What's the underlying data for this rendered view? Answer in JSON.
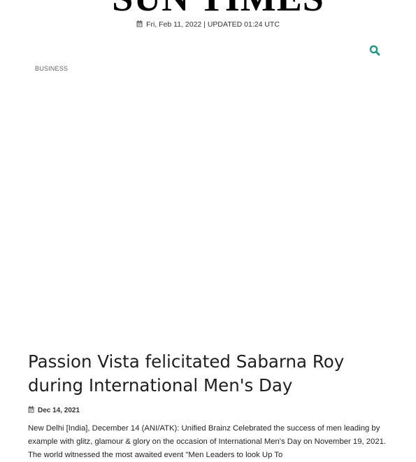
{
  "masthead": {
    "logo_text": "SUN TIMES",
    "date": "Fri, Feb 11, 2022",
    "separator": " | ",
    "updated": "UPDATED 01:24 UTC"
  },
  "header": {
    "search_icon": "search-icon"
  },
  "article": {
    "category": "BUSINESS",
    "title": "Passion Vista felicitated Sabarna Roy during International Men's Day",
    "date": "Dec 14, 2021",
    "body": "New Delhi [India], December 14 (ANI/ATK): Unified Brainz Celebrated the success of men leading by example with glitz, glamour & glory on the occasion of International Men's Day on November 19, 2021. The world witnessed the most awaited event \"Men Leaders to look Up To"
  },
  "colors": {
    "accent": "#1a9a8a",
    "text": "#222222"
  }
}
